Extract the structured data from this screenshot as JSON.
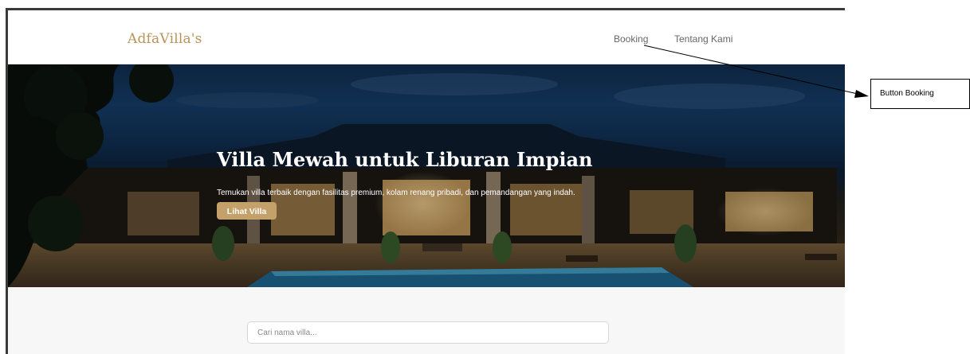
{
  "navbar": {
    "brand": "AdfaVilla's",
    "links": [
      {
        "label": "Booking"
      },
      {
        "label": "Tentang Kami"
      }
    ]
  },
  "hero": {
    "title": "Villa Mewah untuk Liburan Impian",
    "subtitle": "Temukan villa terbaik dengan fasilitas premium, kolam renang pribadi, dan pemandangan yang indah.",
    "button_label": "Lihat Villa"
  },
  "search": {
    "placeholder": "Cari nama villa..."
  },
  "annotation": {
    "label": "Button Booking"
  },
  "colors": {
    "brand": "#b8935a",
    "accent_button": "#c4a06a",
    "nav_text": "#666666"
  }
}
